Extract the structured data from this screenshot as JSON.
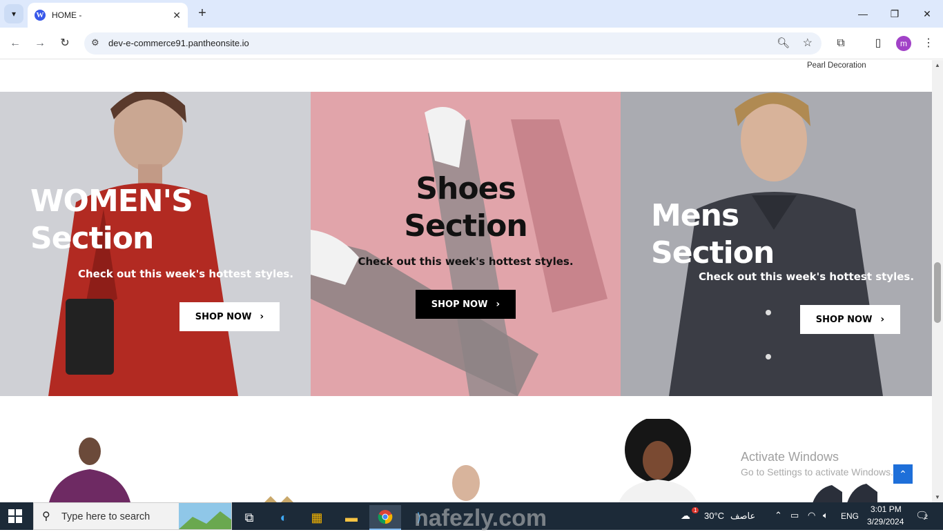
{
  "browser": {
    "tab_title": "HOME -",
    "url": "dev-e-commerce91.pantheonsite.io",
    "profile_initial": "m"
  },
  "page": {
    "top_product_caption": "Pearl Decoration",
    "sections": [
      {
        "title_line1": "WOMEN'S",
        "title_line2": "Section",
        "subtitle": "Check out this week's hottest styles.",
        "button": "SHOP NOW"
      },
      {
        "title_line1": "Shoes",
        "title_line2": "Section",
        "subtitle": "Check out this week's hottest styles.",
        "button": "SHOP NOW"
      },
      {
        "title_line1": "Mens",
        "title_line2": "Section",
        "subtitle": "Check out this week's hottest styles.",
        "button": "SHOP NOW"
      }
    ],
    "activate_title": "Activate Windows",
    "activate_sub": "Go to Settings to activate Windows.",
    "watermark": "nafezly.com"
  },
  "taskbar": {
    "search_placeholder": "Type here to search",
    "temperature": "30°C",
    "weather": "عاصف",
    "weather_badge": "1",
    "language": "ENG",
    "time": "3:01 PM",
    "date": "3/29/2024",
    "notification_count": "2"
  },
  "colors": {
    "women_bg": "#cccdd2",
    "shoes_bg": "#e1a4aa",
    "mens_bg": "#a9aab0",
    "taskbar": "#1c2a38",
    "accent": "#1e6fd9"
  }
}
